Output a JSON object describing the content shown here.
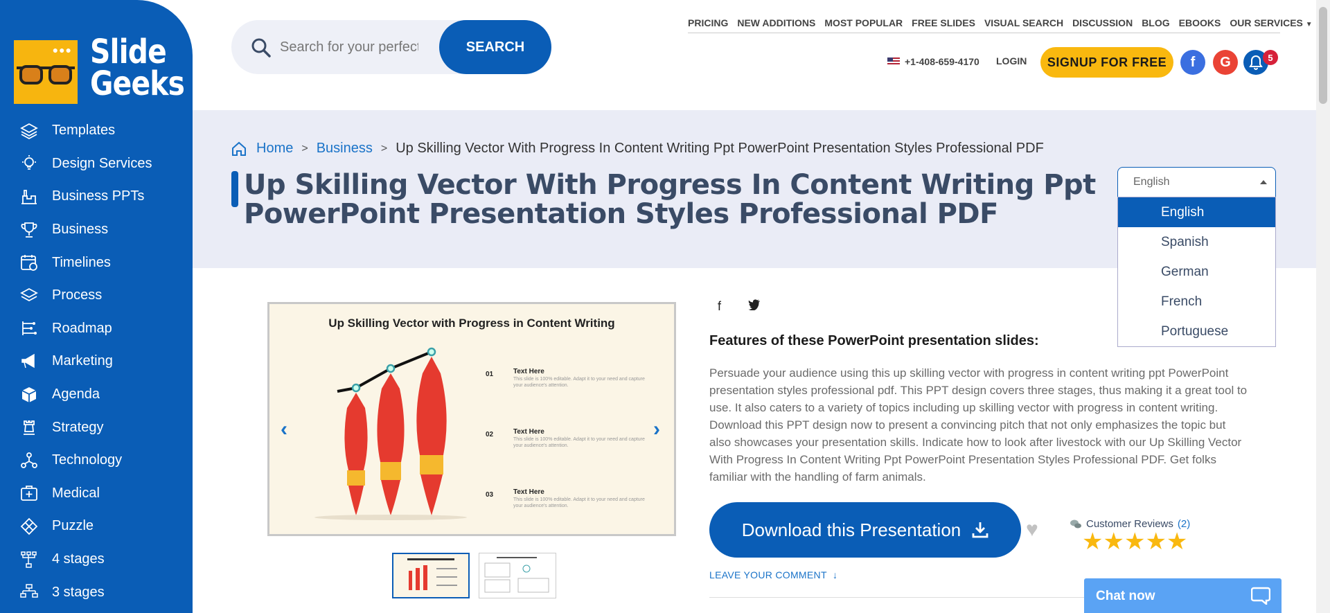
{
  "brand": {
    "line1": "Slide",
    "line2": "Geeks",
    "dots": "●●●"
  },
  "sidebar": {
    "items": [
      {
        "label": "Templates",
        "icon": "layers-icon"
      },
      {
        "label": "Design Services",
        "icon": "lightbulb-icon"
      },
      {
        "label": "Business PPTs",
        "icon": "factory-icon"
      },
      {
        "label": "Business",
        "icon": "trophy-icon"
      },
      {
        "label": "Timelines",
        "icon": "calendar-clock-icon"
      },
      {
        "label": "Process",
        "icon": "layers-icon"
      },
      {
        "label": "Roadmap",
        "icon": "roadmap-icon"
      },
      {
        "label": "Marketing",
        "icon": "megaphone-icon"
      },
      {
        "label": "Agenda",
        "icon": "cube-icon"
      },
      {
        "label": "Strategy",
        "icon": "chess-rook-icon"
      },
      {
        "label": "Technology",
        "icon": "network-icon"
      },
      {
        "label": "Medical",
        "icon": "medical-kit-icon"
      },
      {
        "label": "Puzzle",
        "icon": "puzzle-icon"
      },
      {
        "label": "4 stages",
        "icon": "hierarchy-4-icon"
      },
      {
        "label": "3 stages",
        "icon": "hierarchy-3-icon"
      }
    ]
  },
  "search": {
    "placeholder": "Search for your perfect",
    "button": "SEARCH"
  },
  "topnav": [
    "PRICING",
    "NEW ADDITIONS",
    "MOST POPULAR",
    "FREE SLIDES",
    "VISUAL SEARCH",
    "DISCUSSION",
    "BLOG",
    "EBOOKS",
    "OUR SERVICES"
  ],
  "header": {
    "phone": "+1-408-659-4170",
    "login": "LOGIN",
    "signup": "SIGNUP FOR FREE",
    "facebook": "f",
    "google": "G",
    "notifications": "5"
  },
  "breadcrumb": {
    "home": "Home",
    "category": "Business",
    "current": "Up Skilling Vector With Progress In Content Writing Ppt PowerPoint Presentation Styles Professional PDF"
  },
  "page_title": "Up Skilling Vector With Progress In Content Writing Ppt PowerPoint Presentation Styles Professional PDF",
  "language": {
    "selected": "English",
    "options": [
      "English",
      "Spanish",
      "German",
      "French",
      "Portuguese"
    ]
  },
  "slide": {
    "title": "Up Skilling Vector with Progress in Content Writing",
    "items": [
      {
        "num": "01",
        "title": "Text Here",
        "body": "This slide is 100% editable. Adapt it to your need and capture your audience's attention."
      },
      {
        "num": "02",
        "title": "Text Here",
        "body": "This slide is 100% editable. Adapt it to your need and capture your audience's attention."
      },
      {
        "num": "03",
        "title": "Text Here",
        "body": "This slide is 100% editable. Adapt it to your need and capture your audience's attention."
      }
    ],
    "colors": {
      "accent_red": "#e53a2f",
      "accent_yellow": "#f5b82e",
      "teal": "#3aa0a8"
    }
  },
  "product": {
    "features_heading": "Features of these PowerPoint presentation slides:",
    "description": "Persuade your audience using this up skilling vector with progress in content writing ppt PowerPoint presentation styles professional pdf. This PPT design covers three stages, thus making it a great tool to use. It also caters to a variety of topics including up skilling vector with progress in content writing. Download this PPT design now to present a convincing pitch that not only emphasizes the topic but also showcases your presentation skills. Indicate how to look after livestock with our Up Skilling Vector With Progress In Content Writing Ppt PowerPoint Presentation Styles Professional PDF. Get folks familiar with the handling of farm animals.",
    "download": "Download this Presentation",
    "reviews_label": "Customer Reviews",
    "reviews_count": "(2)",
    "rating": 5,
    "stars": "★★★★★",
    "leave_comment": "LEAVE YOUR COMMENT",
    "leave_arrow": "↓"
  },
  "chat": {
    "label": "Chat now"
  },
  "colors": {
    "brand_blue": "#0a5db6",
    "signup_yellow": "#f9b80f",
    "link_blue": "#1a73c8"
  }
}
